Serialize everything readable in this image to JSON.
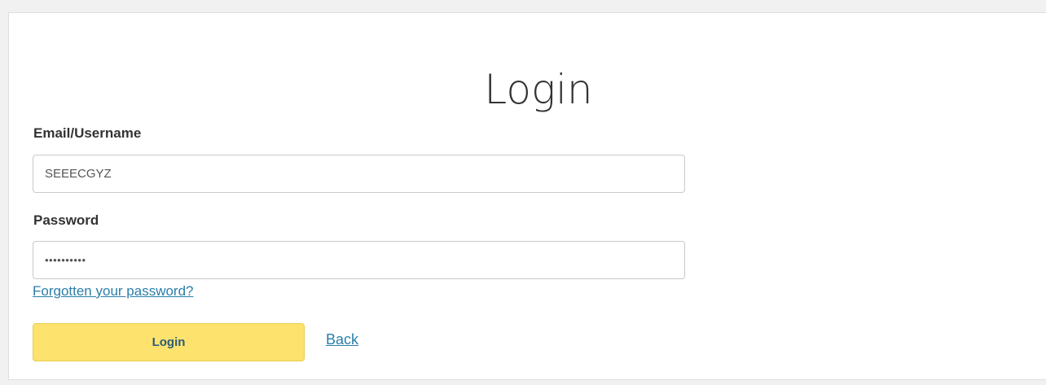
{
  "page": {
    "title": "Login"
  },
  "form": {
    "email_label": "Email/Username",
    "email_value": "SEEECGYZ",
    "password_label": "Password",
    "password_value": "••••••••••",
    "forgot_link": "Forgotten your password?",
    "login_button": "Login",
    "back_link": "Back"
  },
  "colors": {
    "login_button_bg": "#fde36d",
    "link": "#2b7ea8"
  }
}
